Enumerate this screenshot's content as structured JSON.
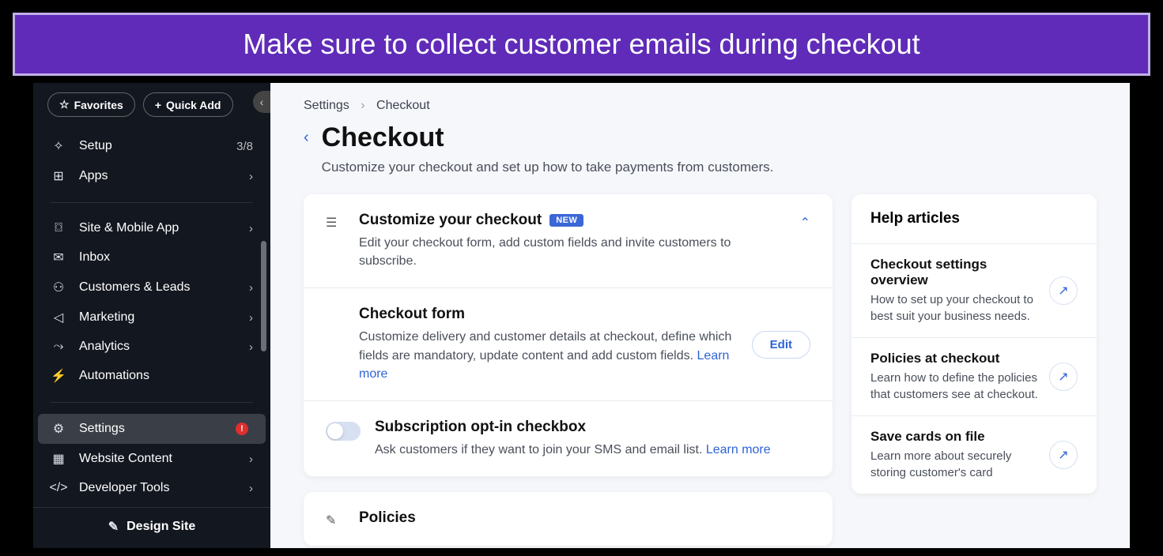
{
  "banner": "Make sure to collect customer emails during checkout",
  "pills": {
    "favorites": "Favorites",
    "quickAdd": "Quick Add"
  },
  "nav": {
    "setup": {
      "label": "Setup",
      "tail": "3/8"
    },
    "apps": "Apps",
    "site": "Site & Mobile App",
    "inbox": "Inbox",
    "customers": "Customers & Leads",
    "marketing": "Marketing",
    "analytics": "Analytics",
    "automations": "Automations",
    "settings": "Settings",
    "website": "Website Content",
    "developer": "Developer Tools",
    "design": "Design Site"
  },
  "breadcrumb": {
    "a": "Settings",
    "b": "Checkout"
  },
  "page": {
    "title": "Checkout",
    "subtitle": "Customize your checkout and set up how to take payments from customers."
  },
  "sections": {
    "customize": {
      "title": "Customize your checkout",
      "badge": "NEW",
      "desc": "Edit your checkout form, add custom fields and invite customers to subscribe."
    },
    "form": {
      "title": "Checkout form",
      "desc": "Customize delivery and customer details at checkout, define which fields are mandatory, update content and add custom fields. ",
      "learn": "Learn more",
      "edit": "Edit"
    },
    "subscription": {
      "title": "Subscription opt-in checkbox",
      "desc": "Ask customers if they want to join your SMS and email list. ",
      "learn": "Learn more"
    },
    "policies": {
      "title": "Policies"
    }
  },
  "help": {
    "title": "Help articles",
    "items": [
      {
        "title": "Checkout settings overview",
        "desc": "How to set up your checkout to best suit your business needs."
      },
      {
        "title": "Policies at checkout",
        "desc": "Learn how to define the policies that customers see at checkout."
      },
      {
        "title": "Save cards on file",
        "desc": "Learn more about securely storing customer's card"
      }
    ]
  }
}
